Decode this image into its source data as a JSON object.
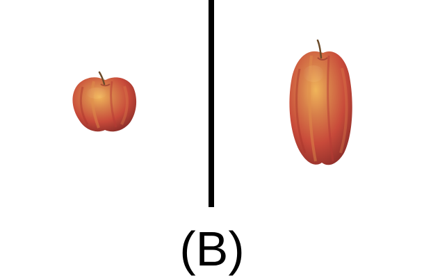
{
  "caption": "(B)",
  "colors": {
    "background": "#ffffff",
    "divider": "#000000",
    "apple_red": "#c84a3a",
    "apple_highlight": "#e8a54d",
    "stem": "#6b4b2a"
  },
  "images": {
    "left": "apple-original",
    "right": "apple-vertically-stretched"
  }
}
